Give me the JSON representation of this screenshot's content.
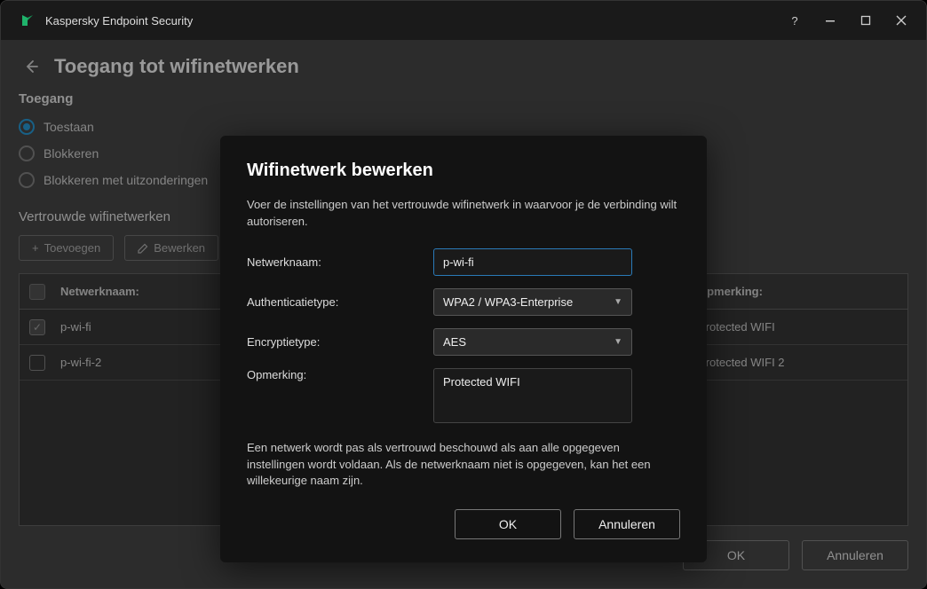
{
  "window": {
    "title": "Kaspersky Endpoint Security"
  },
  "page": {
    "title": "Toegang tot wifinetwerken",
    "access_label": "Toegang",
    "radios": {
      "allow": "Toestaan",
      "block": "Blokkeren",
      "block_ex": "Blokkeren met uitzonderingen"
    },
    "trusted_label": "Vertrouwde wifinetwerken",
    "toolbar": {
      "add": "Toevoegen",
      "edit": "Bewerken"
    },
    "table": {
      "col_name": "Netwerknaam:",
      "col_remark": "Opmerking:",
      "rows": [
        {
          "name": "p-wi-fi",
          "remark": "Protected WIFI",
          "checked": true
        },
        {
          "name": "p-wi-fi-2",
          "remark": "Protected WIFI 2",
          "checked": false
        }
      ]
    },
    "footer": {
      "ok": "OK",
      "cancel": "Annuleren"
    }
  },
  "modal": {
    "title": "Wifinetwerk bewerken",
    "desc": "Voer de instellingen van het vertrouwde wifinetwerk in waarvoor je de verbinding wilt autoriseren.",
    "labels": {
      "name": "Netwerknaam:",
      "auth": "Authenticatietype:",
      "enc": "Encryptietype:",
      "remark": "Opmerking:"
    },
    "values": {
      "name": "p-wi-fi",
      "auth": "WPA2 / WPA3-Enterprise",
      "enc": "AES",
      "remark": "Protected WIFI"
    },
    "note": "Een netwerk wordt pas als vertrouwd beschouwd als aan alle opgegeven instellingen wordt voldaan. Als de netwerknaam niet is opgegeven, kan het een willekeurige naam zijn.",
    "footer": {
      "ok": "OK",
      "cancel": "Annuleren"
    }
  }
}
